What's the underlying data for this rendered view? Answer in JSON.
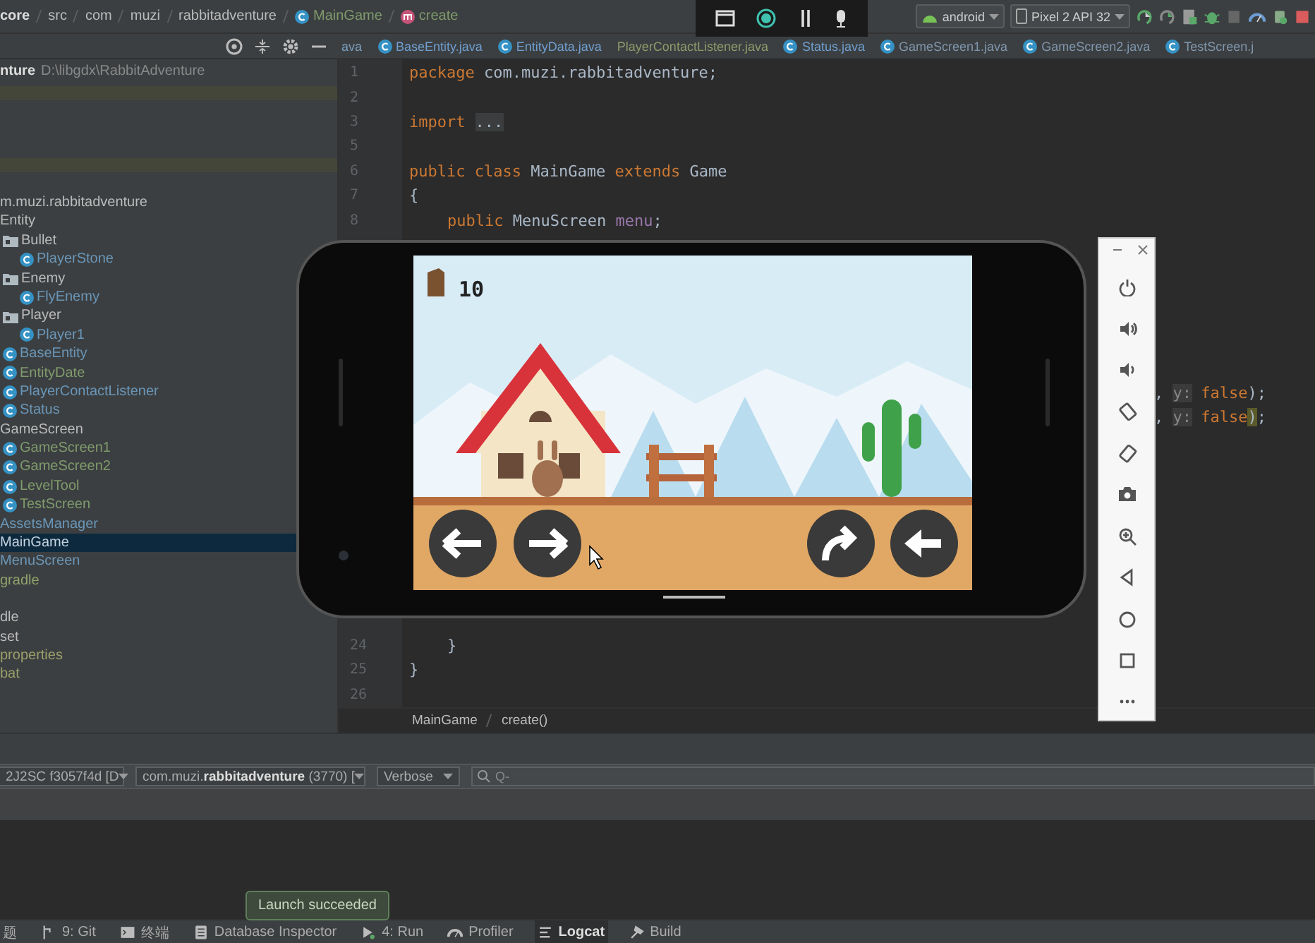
{
  "breadcrumb": [
    {
      "label": "core",
      "kind": "module"
    },
    {
      "label": "src",
      "kind": "dir"
    },
    {
      "label": "com",
      "kind": "dir"
    },
    {
      "label": "muzi",
      "kind": "dir"
    },
    {
      "label": "rabbitadventure",
      "kind": "dir"
    },
    {
      "label": "MainGame",
      "kind": "class"
    },
    {
      "label": "create",
      "kind": "method"
    }
  ],
  "run_toolbar": {
    "configuration": "android",
    "device": "Pixel 2 API 32"
  },
  "editor_tabs": [
    {
      "label": "ava",
      "kind": "plain",
      "color": "#7a9fbf",
      "selected": false
    },
    {
      "label": "BaseEntity.java",
      "kind": "class",
      "color": "#6f9fd0",
      "selected": false
    },
    {
      "label": "EntityData.java",
      "kind": "class",
      "color": "#6f9fd0",
      "selected": false
    },
    {
      "label": "PlayerContactListener.java",
      "kind": "plain",
      "color": "#8d9a6a",
      "selected": false
    },
    {
      "label": "Status.java",
      "kind": "class",
      "color": "#6f9fd0",
      "selected": false
    },
    {
      "label": "GameScreen1.java",
      "kind": "class",
      "color": "#7f96ad",
      "selected": false
    },
    {
      "label": "GameScreen2.java",
      "kind": "class",
      "color": "#7f96ad",
      "selected": false
    },
    {
      "label": "TestScreen.j",
      "kind": "class",
      "color": "#7f96ad",
      "selected": false
    }
  ],
  "project_tree": {
    "root": {
      "name": "nture",
      "path": "D:\\libgdx\\RabbitAdventure"
    },
    "items": [
      {
        "label": "m.muzi.rabbitadventure",
        "color": "#bbbbbb",
        "selected": false,
        "children": [
          {
            "label": "Entity",
            "color": "#bbbbbb",
            "selected": false,
            "children": [
              {
                "label": "Bullet",
                "kind": "folder",
                "color": "#bbbbbb",
                "selected": false,
                "children": [
                  {
                    "label": "PlayerStone",
                    "kind": "class",
                    "color": "#6a96b8",
                    "selected": false
                  }
                ]
              },
              {
                "label": "Enemy",
                "kind": "folder",
                "color": "#bbbbbb",
                "selected": false,
                "children": [
                  {
                    "label": "FlyEnemy",
                    "kind": "class",
                    "color": "#6a96b8",
                    "selected": false
                  }
                ]
              },
              {
                "label": "Player",
                "kind": "folder",
                "color": "#bbbbbb",
                "selected": false,
                "children": [
                  {
                    "label": "Player1",
                    "kind": "class",
                    "color": "#6a96b8",
                    "selected": false
                  }
                ]
              },
              {
                "label": "BaseEntity",
                "kind": "class",
                "color": "#6a96b8",
                "selected": false
              },
              {
                "label": "EntityDate",
                "kind": "class",
                "color": "#7f9a6c",
                "selected": false
              },
              {
                "label": "PlayerContactListener",
                "kind": "class",
                "color": "#6a96b8",
                "selected": false
              },
              {
                "label": "Status",
                "kind": "class",
                "color": "#6a96b8",
                "selected": false
              }
            ]
          },
          {
            "label": "GameScreen",
            "color": "#bbbbbb",
            "selected": false,
            "children": [
              {
                "label": "GameScreen1",
                "kind": "class",
                "color": "#7f9a6c",
                "selected": false
              },
              {
                "label": "GameScreen2",
                "kind": "class",
                "color": "#7f9a6c",
                "selected": false
              },
              {
                "label": "LevelTool",
                "kind": "class",
                "color": "#7f9a6c",
                "selected": false
              },
              {
                "label": "TestScreen",
                "kind": "class",
                "color": "#7f9a6c",
                "selected": false
              }
            ]
          },
          {
            "label": "AssetsManager",
            "color": "#6a96b8",
            "selected": false
          },
          {
            "label": "MainGame",
            "selected": true
          },
          {
            "label": "MenuScreen",
            "color": "#6a96b8",
            "selected": false
          }
        ]
      },
      {
        "label": "gradle",
        "color": "#8fa36b",
        "selected": false
      }
    ],
    "files": [
      {
        "label": "dle",
        "color": "#bbbbbb"
      },
      {
        "label": "set",
        "color": "#bbbbbb"
      },
      {
        "label": "properties",
        "color": "#9aa06a"
      },
      {
        "label": "bat",
        "color": "#9aa06a"
      }
    ]
  },
  "code": {
    "top_lines": [
      {
        "number": "1",
        "tokens": [
          {
            "text": "package",
            "kind": "keyword"
          },
          {
            "text": " com.muzi.rabbitadventure;",
            "kind": "plain"
          }
        ]
      },
      {
        "number": "2"
      },
      {
        "number": "3",
        "tokens": [
          {
            "text": "import",
            "kind": "keyword"
          },
          {
            "text": "...",
            "kind": "fold"
          }
        ]
      },
      {
        "number": "5"
      },
      {
        "number": "6",
        "tokens": [
          {
            "text": "public class",
            "kind": "keyword"
          },
          {
            "text": " MainGame ",
            "kind": "plain"
          },
          {
            "text": "extends",
            "kind": "keyword"
          },
          {
            "text": " Game",
            "kind": "plain"
          }
        ]
      },
      {
        "number": "7",
        "tokens": [
          {
            "text": "{",
            "kind": "plain"
          }
        ]
      },
      {
        "number": "8",
        "indented": true,
        "tokens": [
          {
            "text": "public",
            "kind": "keyword"
          },
          {
            "text": " MenuScreen ",
            "kind": "plain"
          },
          {
            "text": "menu",
            "kind": "field"
          },
          {
            "text": ";",
            "kind": "plain"
          }
        ]
      }
    ],
    "covered_fragments": [
      {
        "tokens": [
          {
            "text": ", ",
            "kind": "plain"
          },
          {
            "text": "y:",
            "kind": "hint"
          },
          {
            "text": " false",
            "kind": "keyword"
          },
          {
            "text": ");",
            "kind": "plain"
          }
        ]
      },
      {
        "tokens": [
          {
            "text": ", ",
            "kind": "plain"
          },
          {
            "text": "y:",
            "kind": "hint"
          },
          {
            "text": " false",
            "kind": "keyword"
          },
          {
            "text": ")",
            "kind": "brace"
          },
          {
            "text": ";",
            "kind": "plain"
          }
        ]
      }
    ],
    "bottom_lines": [
      {
        "number": "24",
        "indented": true,
        "tokens": [
          {
            "text": "}",
            "kind": "plain"
          }
        ]
      },
      {
        "number": "25",
        "indented": false,
        "tokens": [
          {
            "text": "}",
            "kind": "plain"
          }
        ]
      },
      {
        "number": "26"
      }
    ],
    "breadcrumb": [
      "MainGame",
      "create()"
    ]
  },
  "emulator": {
    "score": "10"
  },
  "logcat": {
    "device": "2J2SC f3057f4d [D",
    "process": "com.muzi.**rabbitadventure** (3770) [",
    "level": "Verbose",
    "search": {
      "placeholder": "Q-"
    }
  },
  "notification": "Launch succeeded",
  "tool_windows": [
    {
      "label": "题",
      "kind": "problems",
      "selected": false
    },
    {
      "label": "9: Git",
      "kind": "git",
      "selected": false
    },
    {
      "label": "终端",
      "kind": "terminal",
      "selected": false
    },
    {
      "label": "Database Inspector",
      "kind": "database",
      "selected": false
    },
    {
      "label": "4: Run",
      "kind": "run",
      "selected": false
    },
    {
      "label": "Profiler",
      "kind": "profiler",
      "selected": false
    },
    {
      "label": "Logcat",
      "kind": "logcat",
      "selected": true
    },
    {
      "label": "Build",
      "kind": "build",
      "selected": false
    }
  ]
}
